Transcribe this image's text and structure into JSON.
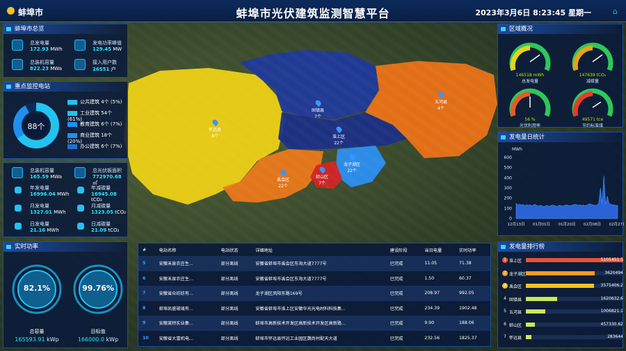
{
  "header": {
    "city": "蚌埠市",
    "title": "蚌埠市光伏建筑监测智慧平台",
    "datetime": "2023年3月6日  8:23:45  星期一"
  },
  "overview": {
    "title": "蚌埠市总览",
    "items": [
      {
        "label": "总发电量",
        "value": "172.93",
        "unit": "MWh"
      },
      {
        "label": "发电功率峰值",
        "value": "129.45",
        "unit": "MW"
      },
      {
        "label": "总装机容量",
        "value": "822.23",
        "unit": "MWa"
      },
      {
        "label": "接入用户数",
        "value": "26551",
        "unit": "户"
      }
    ]
  },
  "key_stations": {
    "title": "重点监控电站",
    "center": "88个",
    "legend": [
      {
        "label": "公共建筑 4个 (5%)",
        "color": "#22c3f0"
      },
      {
        "label": "工业建筑 54个 (61%)",
        "color": "#22c3f0"
      },
      {
        "label": "教育建筑 6个 (7%)",
        "color": "#1f8ff0"
      },
      {
        "label": "商业建筑 18个 (20%)",
        "color": "#1f8ff0"
      },
      {
        "label": "办公建筑 6个 (7%)",
        "color": "#1f6fd0"
      }
    ]
  },
  "capacity": {
    "items": [
      {
        "label": "总装机容量",
        "value": "165.59",
        "unit": "MWa"
      },
      {
        "label": "总光伏板面积",
        "value": "772970.68",
        "unit": "㎡"
      }
    ],
    "grid": [
      {
        "label": "年发电量",
        "value": "16996.04",
        "unit": "MWh"
      },
      {
        "label": "年减碳量",
        "value": "16945.08",
        "unit": "tCO₂"
      },
      {
        "label": "月发电量",
        "value": "1327.01",
        "unit": "MWh"
      },
      {
        "label": "月减碳量",
        "value": "1323.05",
        "unit": "tCO₂"
      },
      {
        "label": "日发电量",
        "value": "21.16",
        "unit": "MWh"
      },
      {
        "label": "日减碳量",
        "value": "21.09",
        "unit": "tCO₂"
      }
    ]
  },
  "realtime": {
    "title": "实时功率",
    "gauges": [
      {
        "value": "82.1%",
        "label": "总容量",
        "sub": "165593.91",
        "unit": "kWp"
      },
      {
        "value": "99.76%",
        "label": "目标值",
        "sub": "166000.0",
        "unit": "kWp"
      }
    ]
  },
  "region_overview": {
    "title": "区域概况",
    "gauges": [
      {
        "value": "146518 mWh",
        "label": "总发电量"
      },
      {
        "value": "147639 tCO₂",
        "label": "减碳量"
      },
      {
        "value": "56 %",
        "label": "光伏利用率"
      },
      {
        "value": "49571 tce",
        "label": "节约标准煤"
      }
    ]
  },
  "daily_chart": {
    "title": "发电量日统计"
  },
  "chart_data": {
    "type": "area",
    "ylabel": "MWh",
    "ylim": [
      0,
      600
    ],
    "yticks": [
      "600",
      "500",
      "400",
      "300",
      "200",
      "100",
      "0"
    ],
    "xticks": [
      "12月13日",
      "01月01日",
      "01月20日",
      "02月08日",
      "02月27日"
    ],
    "values": [
      150,
      135,
      140,
      132,
      138,
      128,
      134,
      130,
      136,
      126,
      132,
      140,
      128,
      122,
      130,
      126,
      118,
      124,
      130,
      120,
      126,
      132,
      128,
      124,
      120,
      130,
      126,
      122,
      128,
      134,
      130,
      126,
      128,
      132,
      140,
      136,
      130,
      134,
      128,
      132,
      126,
      130,
      140,
      146,
      136,
      132,
      128,
      134,
      150,
      300,
      150,
      420,
      140,
      220,
      150,
      140,
      136,
      132,
      128,
      130
    ]
  },
  "map": {
    "regions": [
      {
        "name": "怀远县",
        "count": "8个"
      },
      {
        "name": "固镇县",
        "count": "7个"
      },
      {
        "name": "五河县",
        "count": "4个"
      },
      {
        "name": "淮上区",
        "count": "22个"
      },
      {
        "name": "禹会区",
        "count": "22个"
      },
      {
        "name": "龙子湖区",
        "count": "22个"
      },
      {
        "name": "蚌山区",
        "count": "7个"
      }
    ]
  },
  "table": {
    "headers": [
      "#",
      "电站名称",
      "电站状态",
      "详细地址",
      "建设阶段",
      "当日电量",
      "实时功率"
    ],
    "rows": [
      [
        "5",
        "安徽禾泉农庄生...",
        "部分离线",
        "安徽省蚌埠市禹会区东海大道7777号",
        "已完成",
        "11.05",
        "71.38"
      ],
      [
        "6",
        "安徽禾泉农庄生...",
        "部分离线",
        "安徽省蚌埠市禹会区东海大道7777号",
        "已完成",
        "1.50",
        "60.37"
      ],
      [
        "7",
        "安徽省众纺纺有...",
        "部分离线",
        "龙子湖区凤阳东路169号",
        "已完成",
        "208.97",
        "992.05"
      ],
      [
        "8",
        "蚌埠凯盛玻璃有...",
        "部分离线",
        "安徽省蚌埠市淮上区安徽华光光电材料科技集...",
        "已完成",
        "234.39",
        "1902.48"
      ],
      [
        "9",
        "安徽莱特实业集...",
        "部分离线",
        "蚌埠市高新技术开发区高新技术开发区高新路...",
        "已完成",
        "9.90",
        "188.06"
      ],
      [
        "10",
        "安徽省大富机电...",
        "部分离线",
        "蚌埠市怀远县怀远工业园区魏尚村配天大道",
        "已完成",
        "232.56",
        "1825.37"
      ]
    ]
  },
  "ranking": {
    "title": "发电量排行榜",
    "items": [
      {
        "rank": "1",
        "name": "淮上区",
        "value": "5105451.5",
        "ratio": 1.0,
        "color": "#e8533a"
      },
      {
        "rank": "2",
        "name": "龙子湖区",
        "value": "3620494",
        "ratio": 0.71,
        "color": "#f59a24"
      },
      {
        "rank": "3",
        "name": "禹会区",
        "value": "3575406.2",
        "ratio": 0.7,
        "color": "#f5c324"
      },
      {
        "rank": "4",
        "name": "固镇县",
        "value": "1620632.6",
        "ratio": 0.32,
        "color": "#c9e95a"
      },
      {
        "rank": "5",
        "name": "五河县",
        "value": "1006821.1",
        "ratio": 0.2,
        "color": "#c9e95a"
      },
      {
        "rank": "6",
        "name": "蚌山区",
        "value": "457330.62",
        "ratio": 0.09,
        "color": "#c9e95a"
      },
      {
        "rank": "7",
        "name": "怀远县",
        "value": "283644",
        "ratio": 0.055,
        "color": "#c9e95a"
      }
    ]
  }
}
